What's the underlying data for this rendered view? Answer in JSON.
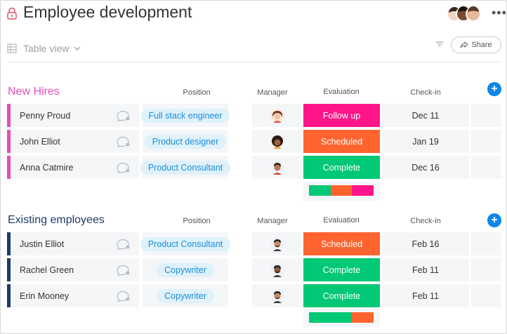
{
  "board": {
    "title": "Employee development"
  },
  "toolbar": {
    "view_label": "Table view",
    "share_label": "Share",
    "more_label": "•••"
  },
  "colors": {
    "new_hires_accent": "#e44fb8",
    "existing_accent": "#1f3a68",
    "status_follow_up": "#ff158a",
    "status_scheduled": "#ff642e",
    "status_complete": "#00c875",
    "add_button": "#0d86e8"
  },
  "columns": {
    "position": "Position",
    "manager": "Manager",
    "evaluation": "Evaluation",
    "checkin": "Check-in"
  },
  "groups": [
    {
      "title": "New Hires",
      "rows": [
        {
          "name": "Penny Proud",
          "position": "Full stack engineer",
          "manager_icon": "avatar-woman-icon",
          "evaluation": "Follow up",
          "checkin": "Dec 11"
        },
        {
          "name": "John Elliot",
          "position": "Product designer",
          "manager_icon": "avatar-woman-curly-icon",
          "evaluation": "Scheduled",
          "checkin": "Jan 19"
        },
        {
          "name": "Anna Catmire",
          "position": "Product Consultant",
          "manager_icon": "avatar-man-icon",
          "evaluation": "Complete",
          "checkin": "Dec 16"
        }
      ],
      "evaluation_summary": [
        {
          "status": "Complete",
          "fraction": 0.333
        },
        {
          "status": "Scheduled",
          "fraction": 0.333
        },
        {
          "status": "Follow up",
          "fraction": 0.334
        }
      ]
    },
    {
      "title": "Existing employees",
      "rows": [
        {
          "name": "Justin Elliot",
          "position": "Product Consultant",
          "manager_icon": "avatar-man-beard-icon",
          "evaluation": "Scheduled",
          "checkin": "Feb 16"
        },
        {
          "name": "Rachel Green",
          "position": "Copywriter",
          "manager_icon": "avatar-man-beard-icon",
          "evaluation": "Complete",
          "checkin": "Feb 11"
        },
        {
          "name": "Erin Mooney",
          "position": "Copywriter",
          "manager_icon": "avatar-man-beard-icon",
          "evaluation": "Complete",
          "checkin": "Feb 11"
        }
      ],
      "evaluation_summary": [
        {
          "status": "Complete",
          "fraction": 0.667
        },
        {
          "status": "Scheduled",
          "fraction": 0.333
        }
      ]
    }
  ]
}
